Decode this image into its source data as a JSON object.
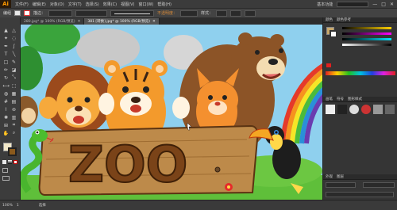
{
  "app": {
    "logo": "Ai"
  },
  "menu": {
    "items": [
      "文件(F)",
      "编辑(E)",
      "对象(O)",
      "文字(T)",
      "选择(S)",
      "效果(C)",
      "视图(V)",
      "窗口(W)",
      "帮助(H)"
    ],
    "workspace": "基本功能",
    "window_controls": [
      "—",
      "□",
      "✕"
    ]
  },
  "control_bar": {
    "object_label": "编组",
    "stroke_label": "描边：",
    "opacity_label": "不透明度：",
    "style_label": "样式："
  },
  "tabs": [
    {
      "label": "280.jpg* @ 100% (RGB/预览)",
      "active": false
    },
    {
      "label": "381 [转换].jpg* @ 100% (RGB/预览)",
      "active": true
    }
  ],
  "artwork": {
    "sign_text": "ZOO"
  },
  "panels": {
    "swatches_tabs": [
      "颜色",
      "颜色参考"
    ],
    "brushes_tabs": [
      "画笔",
      "符号",
      "图形样式"
    ],
    "appearance_tabs": [
      "外观",
      "图层"
    ]
  },
  "status": {
    "zoom": "100%",
    "page": "1",
    "mode": "选择"
  },
  "colors": {
    "accent": "#ff9a00",
    "ui_dark": "#323232"
  }
}
